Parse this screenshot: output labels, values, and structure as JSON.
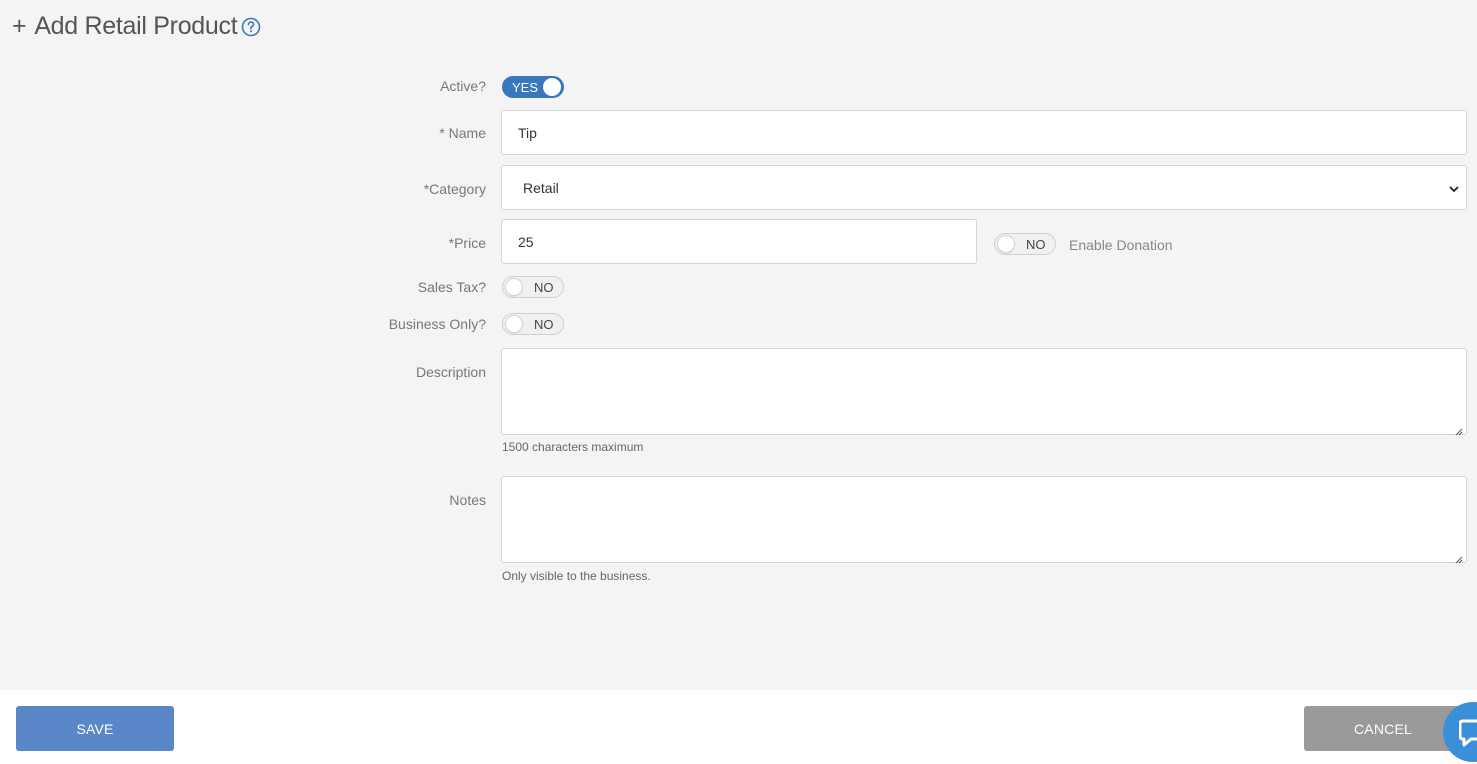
{
  "header": {
    "plus": "+",
    "title": "Add Retail Product",
    "help_icon": "help-circle-icon"
  },
  "form": {
    "active": {
      "label": "Active?",
      "state": "YES"
    },
    "name": {
      "label": "* Name",
      "value": "Tip"
    },
    "category": {
      "label": "*Category",
      "value": "Retail"
    },
    "price": {
      "label": "*Price",
      "value": "25"
    },
    "donation": {
      "state": "NO",
      "label": "Enable Donation"
    },
    "sales_tax": {
      "label": "Sales Tax?",
      "state": "NO"
    },
    "business_only": {
      "label": "Business Only?",
      "state": "NO"
    },
    "description": {
      "label": "Description",
      "value": "",
      "hint": "1500 characters maximum"
    },
    "notes": {
      "label": "Notes",
      "value": "",
      "hint": "Only visible to the business."
    }
  },
  "footer": {
    "save_label": "SAVE",
    "cancel_label": "CANCEL",
    "chat_icon": "chat-bubble-icon"
  },
  "colors": {
    "accent": "#3a78bd",
    "save_button": "#5a87c8",
    "cancel_button": "#9a9a9a",
    "chat_fab": "#3a8fd8"
  }
}
